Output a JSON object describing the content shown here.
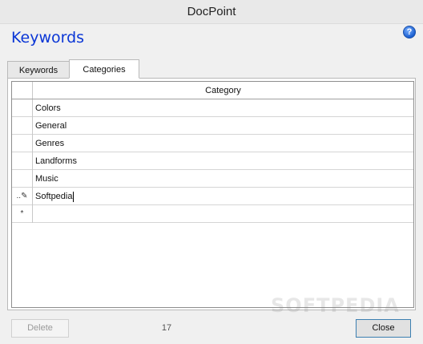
{
  "window": {
    "title": "DocPoint"
  },
  "heading": "Keywords",
  "help_icon": "?",
  "tabs": [
    {
      "label": "Keywords",
      "active": false
    },
    {
      "label": "Categories",
      "active": true
    }
  ],
  "grid": {
    "column_header": "Category",
    "rows": [
      {
        "marker": "",
        "value": "Colors"
      },
      {
        "marker": "",
        "value": "General"
      },
      {
        "marker": "",
        "value": "Genres"
      },
      {
        "marker": "",
        "value": "Landforms"
      },
      {
        "marker": "",
        "value": "Music"
      },
      {
        "marker": "..✎",
        "value": "Softpedia",
        "editing": true
      },
      {
        "marker": "*",
        "value": ""
      }
    ]
  },
  "footer": {
    "delete_label": "Delete",
    "delete_enabled": false,
    "count": "17",
    "close_label": "Close"
  },
  "watermark": "SOFTPEDIA",
  "colors": {
    "heading": "#0a36d6",
    "close_border": "#3c7fb1"
  }
}
